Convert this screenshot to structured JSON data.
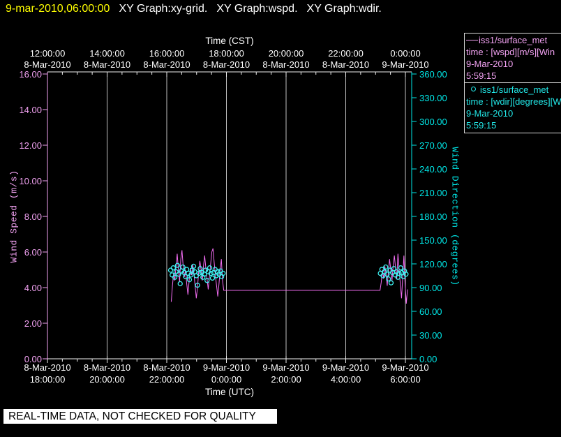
{
  "window": {
    "title_time": "9-mar-2010,06:00:00",
    "title_items": [
      "XY Graph:xy-grid.",
      "XY Graph:wspd.",
      "XY Graph:wdir."
    ]
  },
  "status_banner": "REAL-TIME DATA, NOT CHECKED FOR QUALITY",
  "legend": {
    "entries": [
      {
        "marker": "line-sample",
        "name": "iss1/surface_met",
        "detail": "time : [wspd][m/s][Win",
        "date": "9-Mar-2010",
        "time": "5:59:15",
        "color": "#f2a2f2"
      },
      {
        "marker": "circle-sample",
        "name": "iss1/surface_met",
        "detail": "time : [wdir][degrees][W",
        "date": "9-Mar-2010",
        "time": "5:59:15",
        "color": "#22e8e8"
      }
    ]
  },
  "colors": {
    "background": "#000000",
    "title_accent": "#ffff00",
    "text": "#ffffff",
    "wspd_axis": "#f2a2f2",
    "wspd_line": "#f26df2",
    "wdir_axis": "#00e8e8",
    "wdir_marker": "#3df2f2",
    "grid": "#c2c2c2",
    "axis_line": "#f0f0f0",
    "banner_bg": "#ffffff",
    "banner_text": "#000000"
  },
  "chart_data": {
    "type": "line",
    "description": "Dual-axis time series: wind speed line (left axis, magenta) and wind direction scatter (right axis, cyan). X axis is hours after 18:00 UTC 8-Mar-2010 (= 12:00 CST).",
    "top_axis": {
      "label": "Time (CST)",
      "tick_times": [
        "12:00:00",
        "14:00:00",
        "16:00:00",
        "18:00:00",
        "20:00:00",
        "22:00:00",
        "0:00:00"
      ],
      "tick_dates": [
        "8-Mar-2010",
        "8-Mar-2010",
        "8-Mar-2010",
        "8-Mar-2010",
        "8-Mar-2010",
        "8-Mar-2010",
        "9-Mar-2010"
      ]
    },
    "bottom_axis": {
      "label": "Time (UTC)",
      "tick_dates": [
        "8-Mar-2010",
        "8-Mar-2010",
        "8-Mar-2010",
        "9-Mar-2010",
        "9-Mar-2010",
        "9-Mar-2010",
        "9-Mar-2010"
      ],
      "tick_times": [
        "18:00:00",
        "20:00:00",
        "22:00:00",
        "0:00:00",
        "2:00:00",
        "4:00:00",
        "6:00:00"
      ]
    },
    "left_axis": {
      "label": "Wind Speed (m/s)",
      "min": 0,
      "max": 16,
      "tick_step": 2,
      "tick_labels": [
        "16.00",
        "14.00",
        "12.00",
        "10.00",
        "8.00",
        "6.00",
        "4.00",
        "2.00",
        "0.00"
      ]
    },
    "right_axis": {
      "label": "Wind Direction (degrees)",
      "min": 0,
      "max": 360,
      "tick_step": 30,
      "tick_labels": [
        "360.00",
        "330.00",
        "300.00",
        "270.00",
        "240.00",
        "210.00",
        "180.00",
        "150.00",
        "120.00",
        "90.00",
        "60.00",
        "30.00",
        "0.00"
      ]
    },
    "x_hours_range": [
      0,
      12.2
    ],
    "major_tick_hours": [
      0,
      2,
      4,
      6,
      8,
      10,
      12
    ],
    "minor_tick_step_hours": 0.5,
    "gridlines_at_hours": [
      2,
      4,
      6,
      8,
      10,
      12
    ],
    "series": [
      {
        "name": "iss1/surface_met wspd (m/s)",
        "type": "line",
        "axis": "left",
        "t": [
          4.15,
          4.19,
          4.23,
          4.27,
          4.31,
          4.35,
          4.39,
          4.43,
          4.47,
          4.51,
          4.55,
          4.59,
          4.63,
          4.67,
          4.71,
          4.75,
          4.79,
          4.83,
          4.87,
          4.91,
          4.95,
          4.99,
          5.03,
          5.07,
          5.11,
          5.15,
          5.19,
          5.23,
          5.27,
          5.31,
          5.35,
          5.39,
          5.43,
          5.47,
          5.51,
          5.55,
          5.59,
          5.63,
          5.67,
          5.71,
          5.75,
          5.79,
          5.83,
          5.87,
          5.91,
          11.15,
          11.19,
          11.23,
          11.27,
          11.31,
          11.35,
          11.39,
          11.43,
          11.47,
          11.51,
          11.55,
          11.59,
          11.63,
          11.67,
          11.71,
          11.75,
          11.79,
          11.83,
          11.87,
          11.91,
          11.95,
          11.99,
          12.03,
          12.07
        ],
        "v": [
          3.2,
          4.1,
          4.8,
          4.4,
          5.2,
          5.9,
          5.0,
          4.3,
          5.6,
          6.1,
          5.2,
          4.6,
          5.0,
          4.2,
          3.6,
          4.4,
          5.1,
          4.7,
          5.3,
          4.8,
          4.1,
          3.4,
          4.0,
          4.9,
          5.5,
          5.0,
          4.4,
          5.2,
          5.8,
          5.1,
          4.5,
          3.9,
          4.6,
          5.3,
          6.0,
          6.2,
          5.4,
          4.7,
          4.1,
          3.5,
          4.2,
          5.0,
          5.6,
          4.4,
          3.85,
          3.85,
          4.3,
          5.0,
          4.5,
          5.2,
          4.8,
          4.1,
          4.9,
          5.6,
          5.0,
          4.4,
          5.2,
          5.8,
          5.1,
          4.5,
          5.9,
          5.0,
          4.2,
          3.4,
          4.6,
          5.8,
          4.2,
          3.1,
          3.9
        ]
      },
      {
        "name": "iss1/surface_met wdir (degrees)",
        "type": "scatter",
        "axis": "right",
        "t": [
          4.13,
          4.18,
          4.22,
          4.27,
          4.31,
          4.36,
          4.4,
          4.45,
          4.49,
          4.54,
          4.58,
          4.63,
          4.67,
          4.72,
          4.76,
          4.81,
          4.85,
          4.9,
          4.94,
          4.99,
          5.03,
          5.08,
          5.12,
          5.17,
          5.21,
          5.26,
          5.3,
          5.35,
          5.39,
          5.44,
          5.48,
          5.53,
          5.57,
          5.62,
          5.66,
          5.71,
          5.75,
          5.8,
          5.84,
          5.89,
          11.16,
          11.21,
          11.25,
          11.3,
          11.34,
          11.39,
          11.43,
          11.48,
          11.52,
          11.57,
          11.61,
          11.66,
          11.7,
          11.75,
          11.79,
          11.84,
          11.88,
          11.93,
          11.97,
          12.02
        ],
        "v": [
          112,
          106,
          115,
          103,
          110,
          118,
          107,
          95,
          111,
          116,
          109,
          104,
          113,
          108,
          100,
          106,
          112,
          117,
          110,
          105,
          93,
          108,
          114,
          109,
          103,
          107,
          112,
          99,
          110,
          115,
          108,
          102,
          109,
          113,
          105,
          110,
          107,
          111,
          104,
          108,
          108,
          113,
          105,
          110,
          116,
          107,
          101,
          112,
          96,
          109,
          114,
          106,
          110,
          103,
          108,
          115,
          109,
          104,
          111,
          107
        ]
      }
    ]
  }
}
